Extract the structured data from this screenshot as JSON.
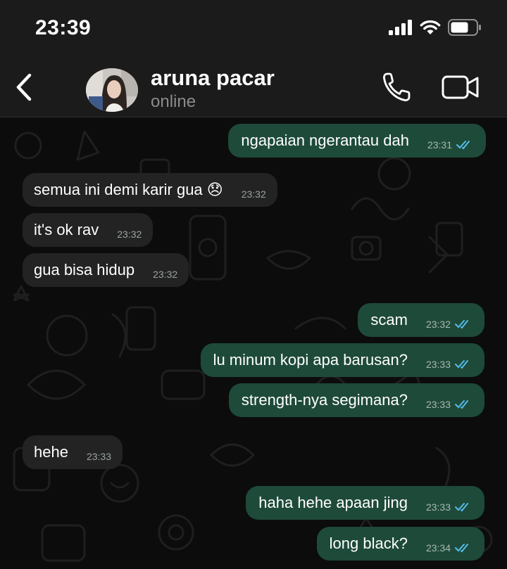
{
  "status_bar": {
    "time": "23:39"
  },
  "header": {
    "name": "aruna pacar",
    "status": "online"
  },
  "messages": [
    {
      "dir": "out",
      "text": "ngapaian ngerantau dah",
      "time": "23:31",
      "read": true
    },
    {
      "dir": "in",
      "text": "semua ini demi karir gua 😞",
      "time": "23:32"
    },
    {
      "dir": "in",
      "text": "it's ok rav",
      "time": "23:32"
    },
    {
      "dir": "in",
      "text": "gua bisa hidup",
      "time": "23:32"
    },
    {
      "dir": "out",
      "text": "scam",
      "time": "23:32",
      "read": true
    },
    {
      "dir": "out",
      "text": "lu minum kopi apa barusan?",
      "time": "23:33",
      "read": true
    },
    {
      "dir": "out",
      "text": "strength-nya segimana?",
      "time": "23:33",
      "read": true
    },
    {
      "dir": "in",
      "text": "hehe",
      "time": "23:33"
    },
    {
      "dir": "out",
      "text": "haha hehe apaan jing",
      "time": "23:33",
      "read": true
    },
    {
      "dir": "out",
      "text": "long black?",
      "time": "23:34",
      "read": true
    }
  ],
  "colors": {
    "outgoing_bubble": "#1e4a3a",
    "incoming_bubble": "#232323",
    "read_ticks": "#53bdeb",
    "header_bg": "#1b1b1b"
  },
  "icons": [
    "signal-icon",
    "wifi-icon",
    "battery-icon",
    "back-chevron-icon",
    "phone-icon",
    "video-camera-icon"
  ]
}
